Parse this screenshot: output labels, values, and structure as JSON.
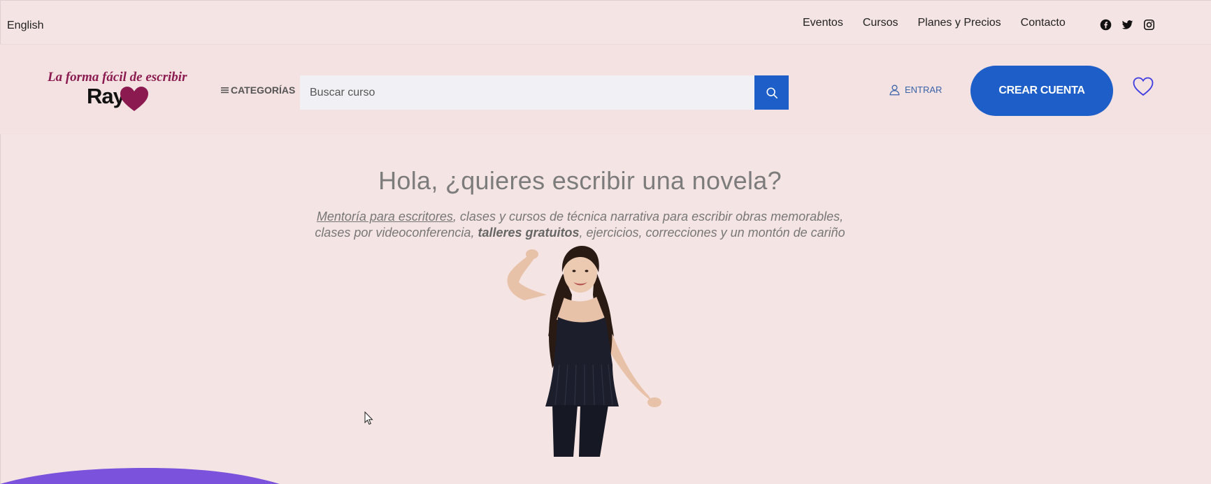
{
  "topbar": {
    "language": "English",
    "nav": [
      "Eventos",
      "Cursos",
      "Planes y Precios",
      "Contacto"
    ],
    "social_icons": [
      "facebook-icon",
      "twitter-icon",
      "instagram-icon"
    ]
  },
  "header": {
    "logo": {
      "line1": "La forma fácil de escribir",
      "line2": "Ray"
    },
    "categories_label": "CATEGORÍAS",
    "search_placeholder": "Buscar curso",
    "login_label": "ENTRAR",
    "create_account_label": "CREAR CUENTA"
  },
  "hero": {
    "title": "Hola, ¿quieres escribir una novela?",
    "sub_link": "Mentoría para escritores",
    "sub_part1": ", clases y cursos de técnica narrativa para escribir obras memorables,",
    "sub_part2": "clases por videoconferencia, ",
    "sub_bold": "talleres gratuitos",
    "sub_part3": ", ejercicios, correcciones y un montón de cariño"
  },
  "colors": {
    "background": "#f5e4e4",
    "accent": "#1e5ec8",
    "logo": "#8a1a4f",
    "wave": "#7a52dc"
  }
}
